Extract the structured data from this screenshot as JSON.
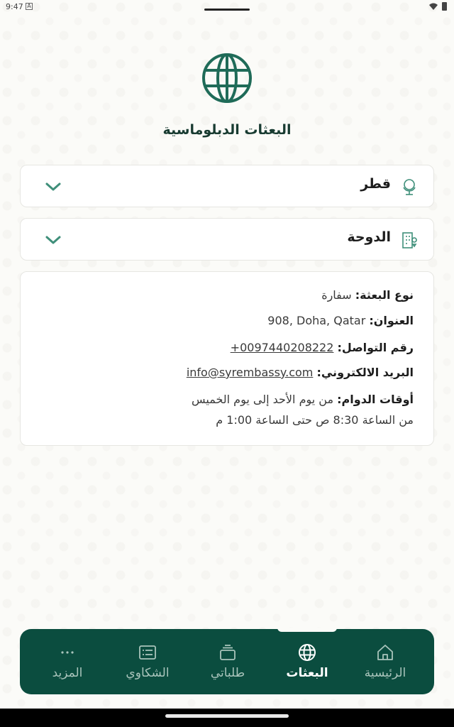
{
  "status": {
    "time": "9:47",
    "notification_icon": "A"
  },
  "title": "البعثات الدبلوماسية",
  "country_select": {
    "value": "قطر",
    "icon": "globe-icon"
  },
  "city_select": {
    "value": "الدوحة",
    "icon": "building-icon"
  },
  "mission": {
    "type_label": "نوع البعثة:",
    "type_value": "سفارة",
    "address_label": "العنوان:",
    "address_value": "908, Doha, Qatar",
    "phone_label": "رقم التواصل:",
    "phone_value": "+0097440208222",
    "email_label": "البريد الالكتروني:",
    "email_value": "info@syrembassy.com",
    "hours_label": "أوقات الدوام:",
    "hours_line1": "من يوم الأحد إلى يوم الخميس",
    "hours_line2": "من الساعة 8:30 ص حتى الساعة 1:00 م"
  },
  "nav": {
    "home": "الرئيسية",
    "missions": "البعثات",
    "requests": "طلباتي",
    "complaints": "الشكاوي",
    "more": "المزيد"
  },
  "colors": {
    "primary": "#0b4d3f",
    "title": "#183b31",
    "background": "#fbfbf8"
  }
}
